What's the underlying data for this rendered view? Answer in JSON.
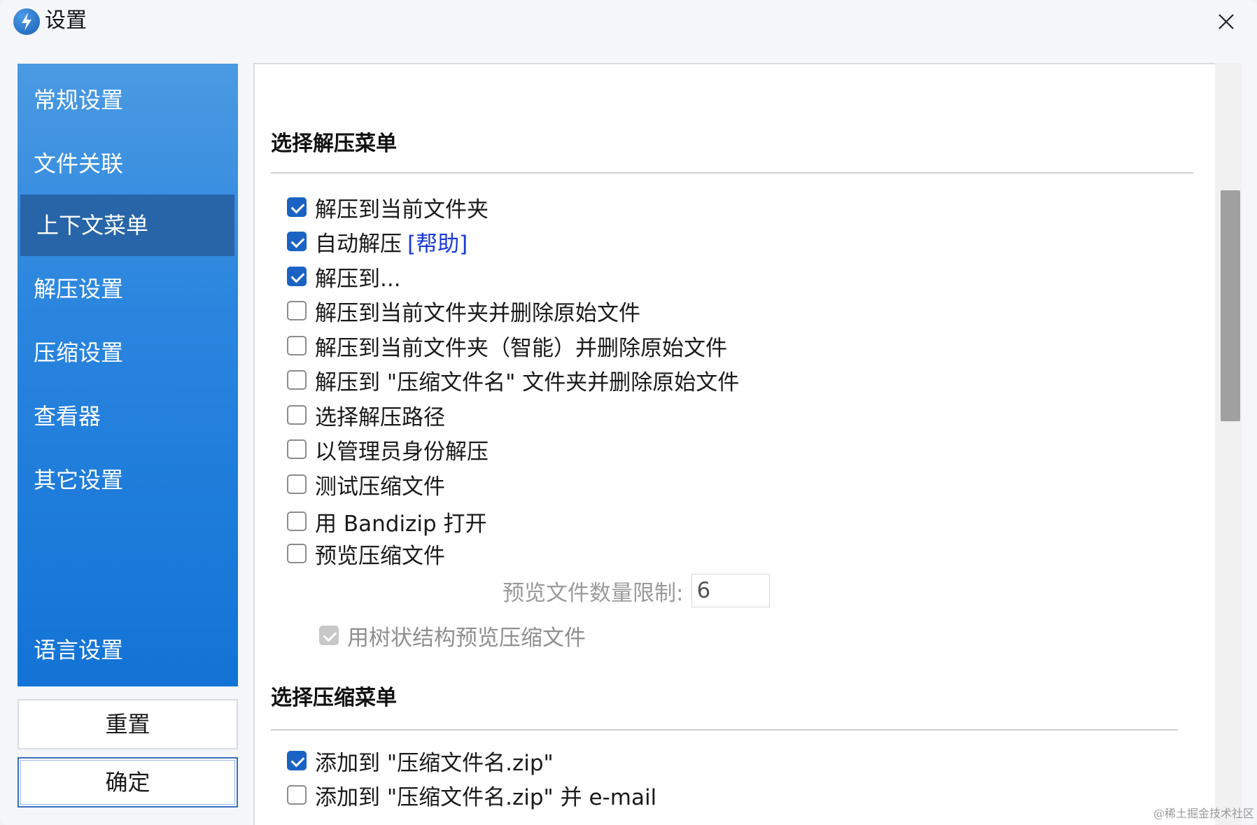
{
  "window": {
    "title": "设置"
  },
  "sidebar": {
    "items": [
      {
        "label": "常规设置"
      },
      {
        "label": "文件关联"
      },
      {
        "label": "上下文菜单",
        "active": true
      },
      {
        "label": "解压设置"
      },
      {
        "label": "压缩设置"
      },
      {
        "label": "查看器"
      },
      {
        "label": "其它设置"
      },
      {
        "label": "语言设置"
      }
    ],
    "reset_label": "重置",
    "ok_label": "确定"
  },
  "extract_menu": {
    "title": "选择解压菜单",
    "options": [
      {
        "label": "解压到当前文件夹",
        "checked": true
      },
      {
        "label": "自动解压",
        "checked": true,
        "link": "[帮助]"
      },
      {
        "label": "解压到...",
        "checked": true
      },
      {
        "label": "解压到当前文件夹并删除原始文件",
        "checked": false
      },
      {
        "label": "解压到当前文件夹（智能）并删除原始文件",
        "checked": false
      },
      {
        "label": "解压到 \"压缩文件名\" 文件夹并删除原始文件",
        "checked": false
      },
      {
        "label": "选择解压路径",
        "checked": false
      },
      {
        "label": "以管理员身份解压",
        "checked": false
      },
      {
        "label": "测试压缩文件",
        "checked": false
      },
      {
        "label": "用 Bandizip 打开",
        "checked": false
      },
      {
        "label": "预览压缩文件",
        "checked": false
      }
    ],
    "preview_limit_label": "预览文件数量限制:",
    "preview_limit_value": "6",
    "tree_preview": {
      "label": "用树状结构预览压缩文件",
      "checked": true,
      "disabled": true
    }
  },
  "compress_menu": {
    "title": "选择压缩菜单",
    "options": [
      {
        "label": "添加到 \"压缩文件名.zip\"",
        "checked": true
      },
      {
        "label": "添加到 \"压缩文件名.zip\" 并 e-mail",
        "checked": false
      }
    ]
  },
  "watermark": "@稀土掘金技术社区",
  "colors": {
    "accent": "#1a63c2",
    "sidebar_active": "#2765a8",
    "link": "#1a3ad6"
  }
}
